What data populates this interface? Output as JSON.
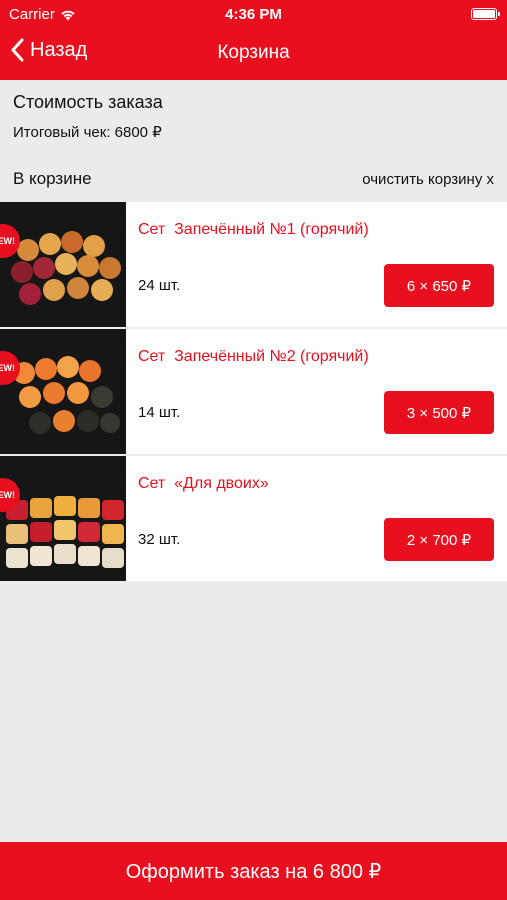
{
  "status_bar": {
    "carrier": "Carrier",
    "time": "4:36 PM"
  },
  "nav": {
    "back_label": "Назад",
    "title": "Корзина"
  },
  "summary": {
    "heading": "Стоимость заказа",
    "total": "Итоговый чек: 6800 ₽"
  },
  "cart": {
    "label": "В корзине",
    "clear_label": "очистить корзину x"
  },
  "items": [
    {
      "name": "Сет  Запечённый №1 (горячий)",
      "qty": "24 шт.",
      "price": "6 × 650 ₽",
      "badge": "NEW!"
    },
    {
      "name": "Сет  Запечённый №2 (горячий)",
      "qty": "14 шт.",
      "price": "3 × 500 ₽",
      "badge": "NEW!"
    },
    {
      "name": "Сет  «Для двоих»",
      "qty": "32 шт.",
      "price": "2 × 700 ₽",
      "badge": "NEW!"
    }
  ],
  "checkout": {
    "label": "Оформить заказ на 6 800 ₽"
  },
  "colors": {
    "accent": "#e8101f",
    "background": "#ebebeb"
  }
}
